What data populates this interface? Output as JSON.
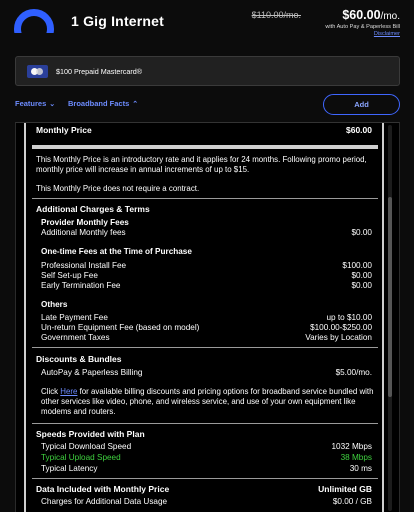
{
  "header": {
    "plan_name": "1 Gig Internet",
    "price_old": "$110.00/mo.",
    "price_new": "$60.00",
    "price_unit": "/mo.",
    "price_note": "with Auto Pay & Paperless Bill",
    "disclaimer": "Disclaimer"
  },
  "offer": {
    "label": "$100 Prepaid Mastercard®",
    "icon": "mastercard-icon"
  },
  "tabs": {
    "features": "Features",
    "facts": "Broadband Facts",
    "add_button": "Add"
  },
  "facts": {
    "monthly_price_label": "Monthly Price",
    "monthly_price_value": "$60.00",
    "intro_text": "This Monthly Price is an introductory rate and it applies for 24 months. Following promo period, monthly price will increase in annual increments of up to $15.",
    "contract_text": "This Monthly Price does not require a contract.",
    "additional_title": "Additional Charges & Terms",
    "provider_fees_title": "Provider Monthly Fees",
    "provider_fees": [
      {
        "label": "Additional Monthly fees",
        "value": "$0.00"
      }
    ],
    "onetime_title": "One-time Fees at the Time of Purchase",
    "onetime_fees": [
      {
        "label": "Professional Install Fee",
        "value": "$100.00"
      },
      {
        "label": "Self Set-up Fee",
        "value": "$0.00"
      },
      {
        "label": "Early Termination Fee",
        "value": "$0.00"
      }
    ],
    "others_title": "Others",
    "others_fees": [
      {
        "label": "Late Payment Fee",
        "value": "up to $10.00"
      },
      {
        "label": "Un-return Equipment Fee (based on model)",
        "value": "$100.00-$250.00"
      },
      {
        "label": "Government Taxes",
        "value": "Varies by Location"
      }
    ],
    "discounts_title": "Discounts & Bundles",
    "discounts": [
      {
        "label": "AutoPay & Paperless Billing",
        "value": "$5.00/mo."
      }
    ],
    "bundle_text_before": "Click ",
    "bundle_link": "Here",
    "bundle_text_after": " for available billing discounts and pricing options for broadband service bundled with other services like video, phone, and wireless service, and use of your own equipment like modems and routers.",
    "speeds_title": "Speeds Provided with Plan",
    "speeds": [
      {
        "label": "Typical Download Speed",
        "value": "1032 Mbps"
      },
      {
        "label": "Typical Upload Speed",
        "value": "38 Mbps"
      },
      {
        "label": "Typical Latency",
        "value": "30 ms"
      }
    ],
    "data_title": "Data Included with Monthly Price",
    "data_value": "Unlimited GB",
    "data_rows": [
      {
        "label": "Charges for Additional Data Usage",
        "value": "$0.00 / GB"
      }
    ]
  },
  "colors": {
    "accent": "#3f66ff",
    "link": "#6d8cff",
    "upload_highlight": "#3fd23f",
    "background": "#0c0c0c"
  }
}
